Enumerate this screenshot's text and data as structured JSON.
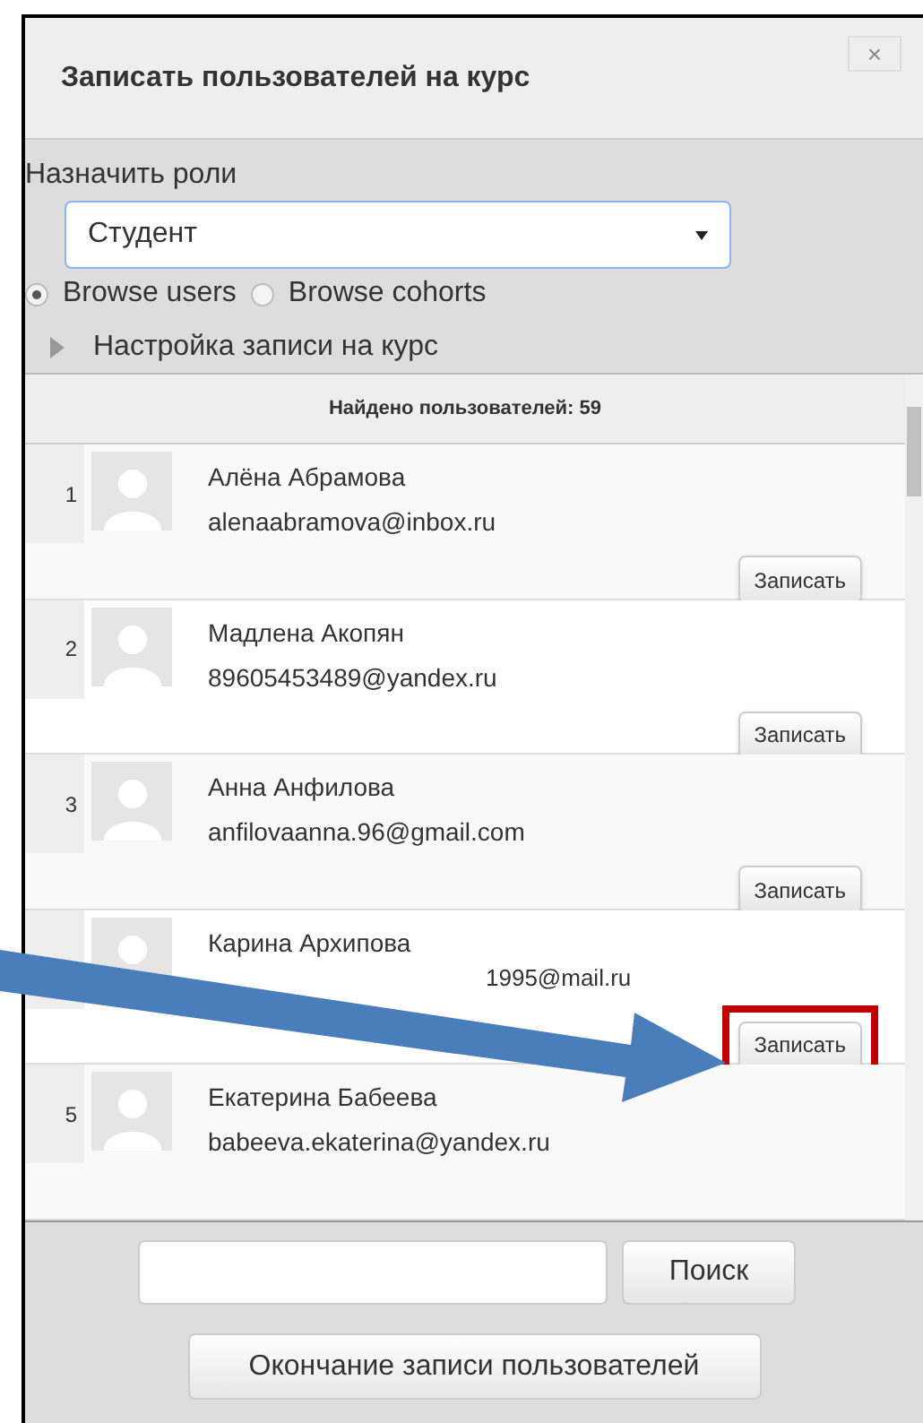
{
  "dialog": {
    "title": "Записать пользователей на курс",
    "close": "×"
  },
  "roles": {
    "label": "Назначить роли",
    "value": "Студент"
  },
  "browse": [
    {
      "label": "Browse users",
      "selected": true
    },
    {
      "label": "Browse cohorts",
      "selected": false
    }
  ],
  "settings": {
    "label": "Настройка записи на курс",
    "expanded": false
  },
  "list": {
    "found": "Найдено пользователей: 59",
    "users": [
      {
        "number": "1",
        "name": "Алёна Абрамова",
        "email": "alenaabramova@inbox.ru",
        "button": "Записать",
        "highlighted": false
      },
      {
        "number": "2",
        "name": "Мадлена Акопян",
        "email": "89605453489@yandex.ru",
        "button": "Записать",
        "highlighted": false
      },
      {
        "number": "3",
        "name": "Анна Анфилова",
        "email": "anfilovaanna.96@gmail.com",
        "button": "Записать",
        "highlighted": false
      },
      {
        "name": "Карина Архипова",
        "email": "1995@mail.ru",
        "button": "Записать",
        "highlighted": true
      },
      {
        "number": "5",
        "name": "Екатерина Бабеева",
        "email": "babeeva.ekaterina@yandex.ru",
        "highlighted": false
      }
    ]
  },
  "search": {
    "button": "Поиск"
  },
  "finish": "Окончание записи пользователей"
}
